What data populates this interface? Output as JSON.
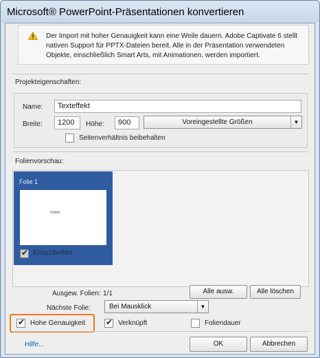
{
  "window": {
    "title": "Microsoft® PowerPoint-Präsentationen konvertieren"
  },
  "warning": {
    "icon": "warning-icon",
    "text": "Der Import mit hoher Genauigkeit kann eine Weile dauern. Adobe Captivate 6 stellt nativen Support für PPTX-Dateien bereit. Alle in der Präsentation verwendeten Objekte, einschließlich Smart Arts, mit Animationen, werden importiert."
  },
  "project": {
    "section_label": "Projekteigenschaften:",
    "name_label": "Name:",
    "name_value": "Texteffekt",
    "width_label": "Breite:",
    "width_value": "1200",
    "height_label": "Höhe:",
    "height_value": "900",
    "preset_dropdown": "Voreingestellte Größen",
    "aspect_label": "Seitenverhältnis beibehalten",
    "aspect_checked": false
  },
  "preview": {
    "section_label": "Folienvorschau:",
    "slide_label": "Folie 1",
    "slide_text": "Online",
    "include_label": "Einschließen",
    "include_checked": true,
    "selection_color": "#2f5ca1"
  },
  "selection": {
    "selected_label": "Ausgew. Folien:",
    "selected_value": "1/1",
    "select_all": "Alle ausw.",
    "delete_all": "Alle löschen",
    "next_label": "Nächste Folie:",
    "next_value": "Bei Mausklick"
  },
  "options": {
    "high_fidelity": "Hohe Genauigkeit",
    "high_fidelity_checked": true,
    "linked": "Verknüpft",
    "linked_checked": true,
    "slide_duration": "Foliendauer",
    "slide_duration_checked": false,
    "highlight_color": "#f07a1a"
  },
  "footer": {
    "help": "Hilfe...",
    "ok": "OK",
    "cancel": "Abbrechen"
  }
}
